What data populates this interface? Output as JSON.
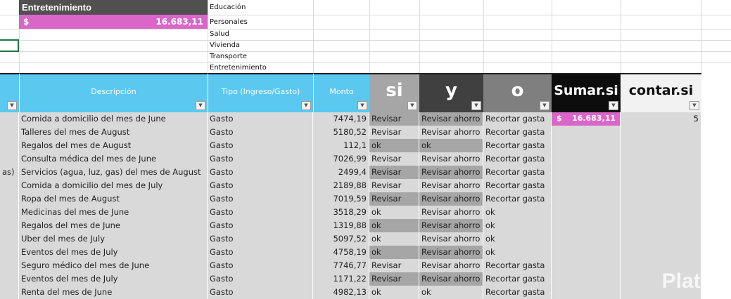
{
  "summary": {
    "title": "Entretenimiento",
    "currency": "$",
    "value": "16.683,11"
  },
  "categories": [
    "Educación",
    "Personales",
    "Salud",
    "Vivienda",
    "Transporte",
    "Entretenimiento"
  ],
  "headers": {
    "descripcion": "Descripción",
    "tipo": "Tipo (Ingreso/Gasto)",
    "monto": "Monto",
    "si": "si",
    "y": "y",
    "o": "o",
    "sumar": "Sumar.si",
    "contar": "contar.si"
  },
  "sumar_result": {
    "currency": "$",
    "value": "16.683,11"
  },
  "contar_result": "5",
  "partial_cell": "as)",
  "rows": [
    {
      "desc": "Comida a domicilio del mes de June",
      "tipo": "Gasto",
      "monto": "7474,19",
      "si": "Revisar",
      "y": "Revisar ahorro",
      "o": "Recortar gasta"
    },
    {
      "desc": "Talleres del mes de August",
      "tipo": "Gasto",
      "monto": "5180,52",
      "si": "Revisar",
      "y": "Revisar ahorro",
      "o": "Recortar gasta"
    },
    {
      "desc": "Regalos del mes de August",
      "tipo": "Gasto",
      "monto": "112,1",
      "si": "ok",
      "y": "ok",
      "o": "Recortar gasta"
    },
    {
      "desc": "Consulta médica del mes de June",
      "tipo": "Gasto",
      "monto": "7026,99",
      "si": "Revisar",
      "y": "Revisar ahorro",
      "o": "Recortar gasta"
    },
    {
      "desc": "Servicios (agua, luz, gas) del mes de August",
      "tipo": "Gasto",
      "monto": "2499,4",
      "si": "Revisar",
      "y": "Revisar ahorro",
      "o": "Recortar gasta"
    },
    {
      "desc": "Comida a domicilio del mes de July",
      "tipo": "Gasto",
      "monto": "2189,88",
      "si": "Revisar",
      "y": "Revisar ahorro",
      "o": "Recortar gasta"
    },
    {
      "desc": "Ropa del mes de August",
      "tipo": "Gasto",
      "monto": "7019,59",
      "si": "Revisar",
      "y": "Revisar ahorro",
      "o": "Recortar gasta"
    },
    {
      "desc": "Medicinas del mes de June",
      "tipo": "Gasto",
      "monto": "3518,29",
      "si": "ok",
      "y": "Revisar ahorro",
      "o": "ok"
    },
    {
      "desc": "Regalos del mes de June",
      "tipo": "Gasto",
      "monto": "1319,88",
      "si": "ok",
      "y": "Revisar ahorro",
      "o": "ok"
    },
    {
      "desc": "Uber del mes de July",
      "tipo": "Gasto",
      "monto": "5097,52",
      "si": "ok",
      "y": "Revisar ahorro",
      "o": "ok"
    },
    {
      "desc": "Eventos del mes de July",
      "tipo": "Gasto",
      "monto": "4758,19",
      "si": "ok",
      "y": "Revisar ahorro",
      "o": "ok"
    },
    {
      "desc": "Seguro médico del mes de June",
      "tipo": "Gasto",
      "monto": "7746,77",
      "si": "Revisar",
      "y": "Revisar ahorro",
      "o": "Recortar gasta"
    },
    {
      "desc": "Eventos del mes de July",
      "tipo": "Gasto",
      "monto": "1171,22",
      "si": "Revisar",
      "y": "Revisar ahorro",
      "o": "Recortar gasta"
    },
    {
      "desc": "Renta del mes de June",
      "tipo": "Gasto",
      "monto": "4982,13",
      "si": "ok",
      "y": "ok",
      "o": "Recortar gasta"
    }
  ],
  "watermark": "Platzi",
  "colors": {
    "header_blue": "#5bc8f0",
    "pink": "#d966c8",
    "dark": "#505050"
  }
}
